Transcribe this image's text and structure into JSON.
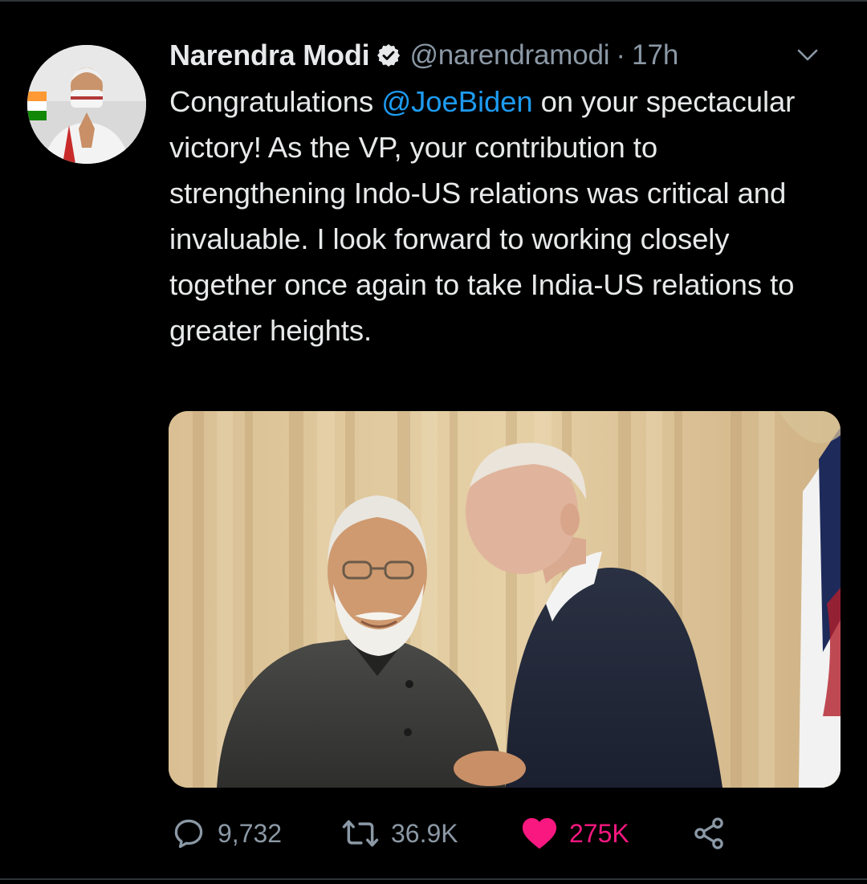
{
  "tweet": {
    "author": {
      "name": "Narendra Modi",
      "handle": "@narendramodi",
      "verified": true,
      "avatar_icon": "profile-photo"
    },
    "separator": "·",
    "time": "17h",
    "text": {
      "before_mention": "Congratulations ",
      "mention": "@JoeBiden",
      "after_mention": " on your spectacular victory! As the VP, your contribution to strengthening Indo-US relations was critical and invaluable. I look forward to working closely together once again to take India-US relations to greater heights."
    },
    "media": {
      "kind": "photo"
    },
    "actions": {
      "reply_count": "9,732",
      "retweet_count": "36.9K",
      "like_count": "275K",
      "liked": true
    }
  },
  "colors": {
    "background": "#000000",
    "text": "#e7e9ea",
    "muted": "#8b98a5",
    "link": "#1d9bf0",
    "like": "#f91880",
    "divider": "#2f3336"
  },
  "icons": {
    "verified": "verified-badge-icon",
    "menu": "chevron-down-icon",
    "reply": "reply-bubble-icon",
    "retweet": "retweet-icon",
    "like": "heart-icon",
    "share": "share-icon"
  }
}
